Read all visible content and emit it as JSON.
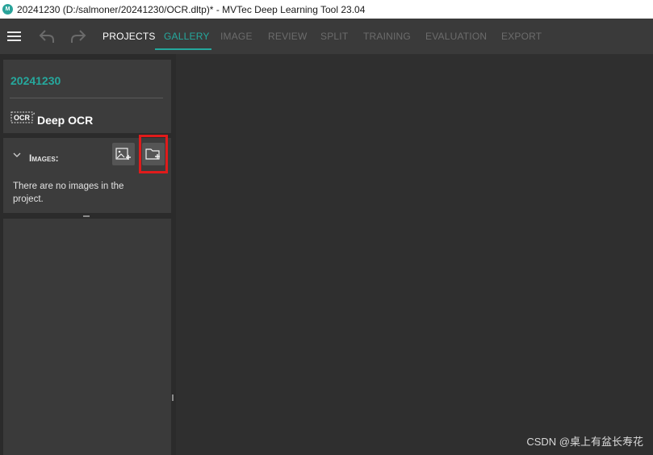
{
  "window": {
    "title": "20241230 (D:/salmoner/20241230/OCR.dltp)* - MVTec Deep Learning Tool 23.04",
    "icon": "mvtec-app-icon"
  },
  "toolbar": {
    "menu_icon": "hamburger-menu-icon",
    "undo_icon": "undo-icon",
    "redo_icon": "redo-icon",
    "tabs": [
      {
        "label": "PROJECTS",
        "state": "active"
      },
      {
        "label": "GALLERY",
        "state": "selected"
      },
      {
        "label": "IMAGE",
        "state": "disabled"
      },
      {
        "label": "REVIEW",
        "state": "disabled"
      },
      {
        "label": "SPLIT",
        "state": "disabled"
      },
      {
        "label": "TRAINING",
        "state": "disabled"
      },
      {
        "label": "EVALUATION",
        "state": "disabled"
      },
      {
        "label": "EXPORT",
        "state": "disabled"
      }
    ]
  },
  "project": {
    "name": "20241230",
    "type_label": "Deep OCR",
    "type_icon": "ocr-icon",
    "type_icon_text": "OCR"
  },
  "images_panel": {
    "header": "Images:",
    "add_image_icon": "add-image-icon",
    "add_folder_icon": "add-folder-icon",
    "empty_message": "There are no images in the project."
  },
  "watermark": "CSDN @桌上有盆长寿花",
  "colors": {
    "accent": "#25a89d",
    "highlight_box": "#e01b1b",
    "toolbar_bg": "#3a3a3a",
    "panel_bg": "#3c3c3c"
  }
}
